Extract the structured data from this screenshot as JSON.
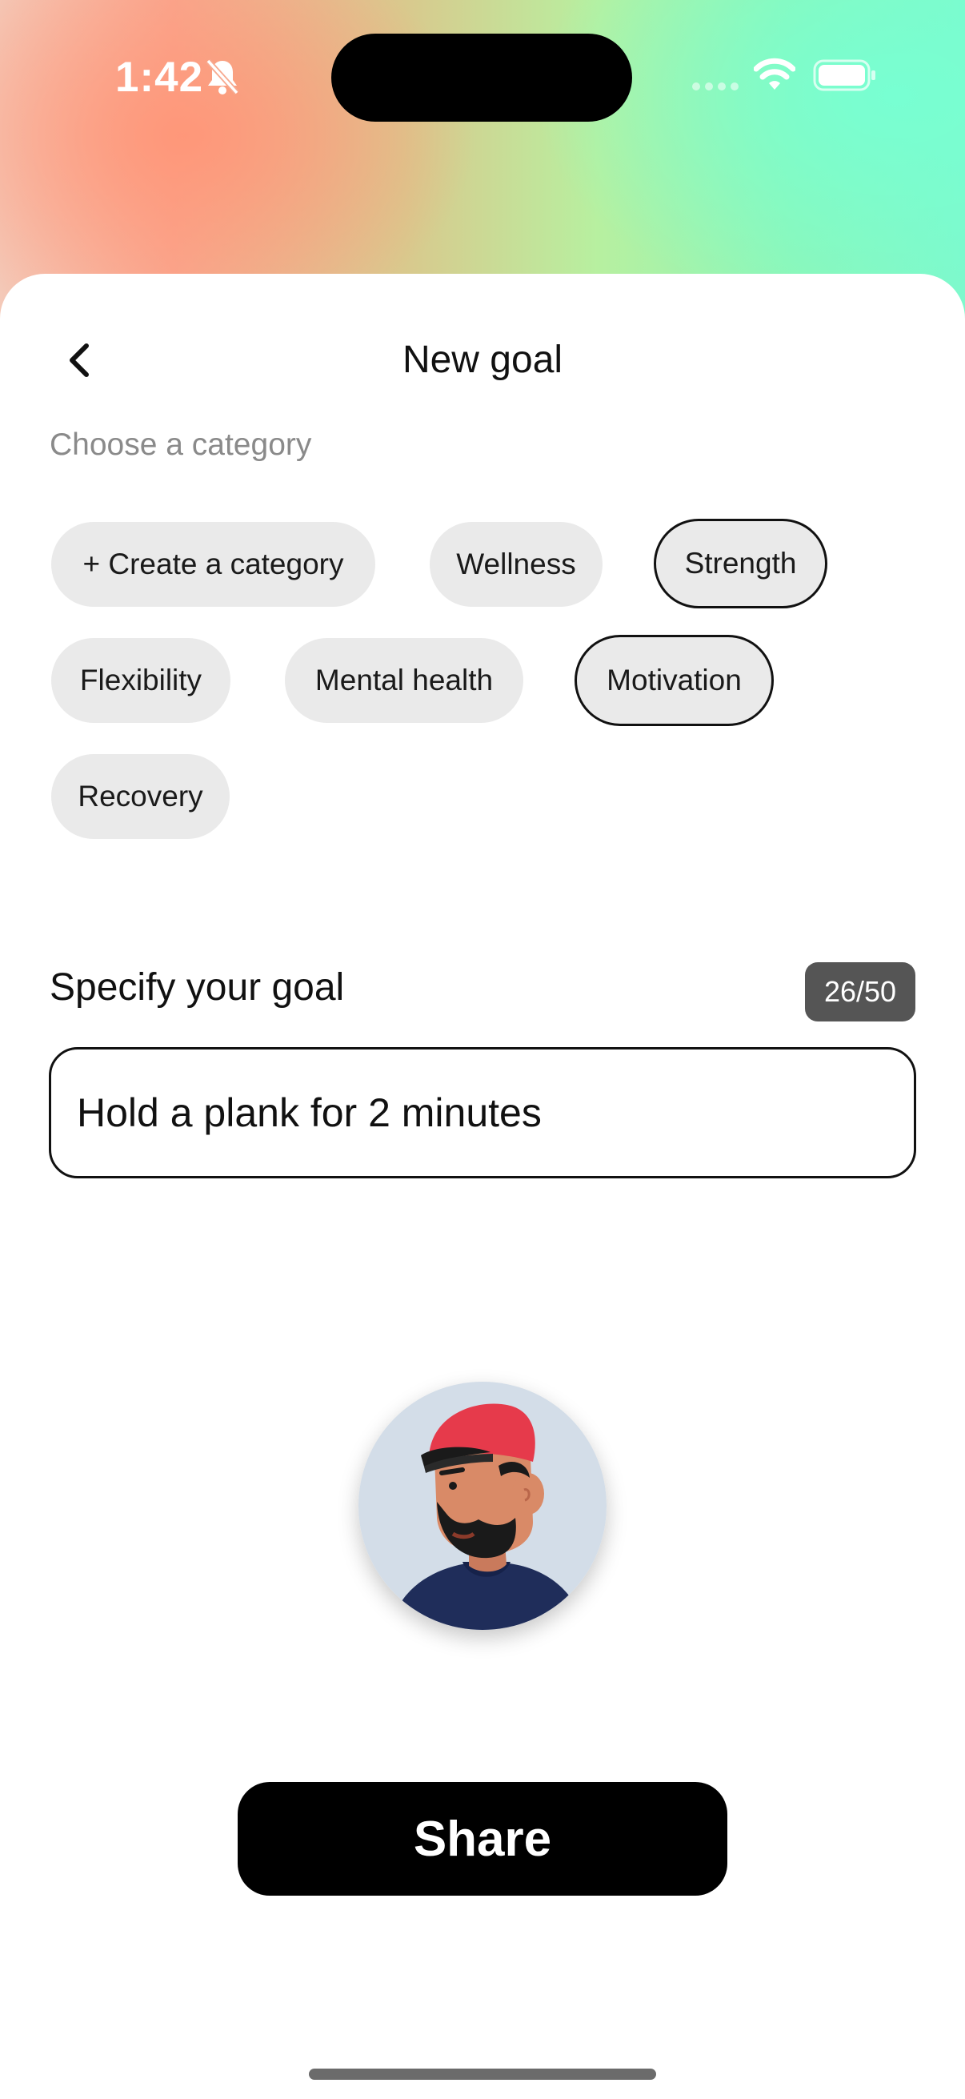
{
  "status_bar": {
    "time": "1:42",
    "icons": [
      "bell-slash-icon",
      "signal-icon",
      "wifi-icon",
      "battery-icon"
    ]
  },
  "header": {
    "title": "New goal",
    "back_icon": "chevron-left-icon"
  },
  "categories": {
    "label": "Choose a category",
    "chips": [
      {
        "label": "+ Create a category",
        "selected": false
      },
      {
        "label": "Wellness",
        "selected": false
      },
      {
        "label": "Strength",
        "selected": true
      },
      {
        "label": "Flexibility",
        "selected": false
      },
      {
        "label": "Mental health",
        "selected": false
      },
      {
        "label": "Motivation",
        "selected": true
      },
      {
        "label": "Recovery",
        "selected": false
      }
    ]
  },
  "goal": {
    "label": "Specify your goal",
    "counter": "26/50",
    "value": "Hold a plank for 2 minutes"
  },
  "avatar": {
    "description_icon": "user-avatar-icon"
  },
  "actions": {
    "share_label": "Share"
  },
  "colors": {
    "accent": "#000000",
    "chip_bg": "#eaeaea",
    "counter_bg": "#555555"
  }
}
